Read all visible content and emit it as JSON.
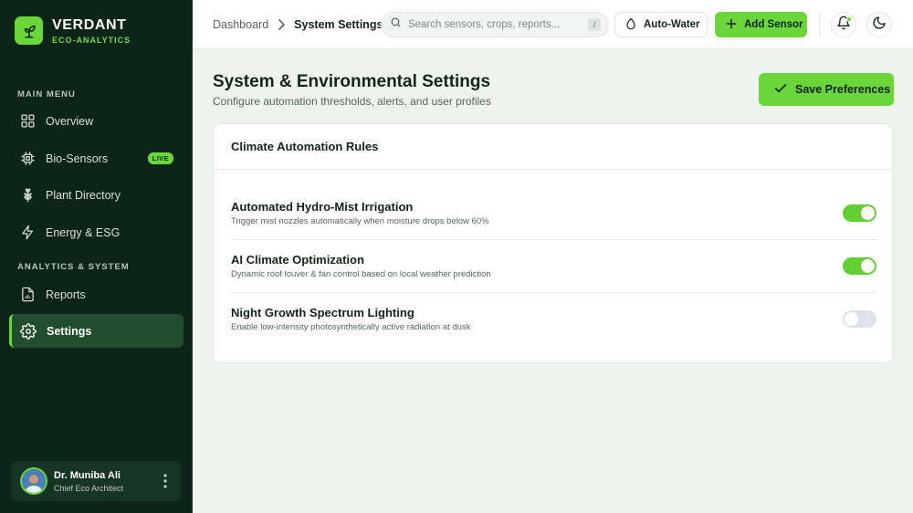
{
  "brand": {
    "name": "VERDANT",
    "subtitle": "ECO-ANALYTICS",
    "logo_icon": "sprout-icon"
  },
  "sidebar": {
    "sections": [
      {
        "title": "MAIN MENU"
      },
      {
        "title": "ANALYTICS & SYSTEM"
      }
    ],
    "items": [
      {
        "label": "Overview",
        "icon": "grid-icon"
      },
      {
        "label": "Bio-Sensors",
        "icon": "chip-icon",
        "badge": "LIVE"
      },
      {
        "label": "Plant Directory",
        "icon": "plant-icon"
      },
      {
        "label": "Energy & ESG",
        "icon": "bolt-icon"
      },
      {
        "label": "Reports",
        "icon": "report-icon"
      },
      {
        "label": "Settings",
        "icon": "gear-icon",
        "active": true
      }
    ]
  },
  "user": {
    "name": "Dr. Muniba Ali",
    "role": "Chief Eco Architect"
  },
  "header": {
    "breadcrumb": [
      "Dashboard",
      "System Settings"
    ],
    "search_placeholder": "Search sensors, crops, reports...",
    "search_shortcut": "/",
    "auto_water_label": "Auto-Water",
    "add_sensor_label": "Add Sensor"
  },
  "main": {
    "title": "System & Environmental Settings",
    "subtitle": "Configure automation thresholds, alerts, and user profiles",
    "save_label": "Save Preferences",
    "card": {
      "title": "Climate Automation Rules",
      "rules": [
        {
          "title": "Automated Hydro-Mist Irrigation",
          "description": "Trigger mist nozzles automatically when moisture drops below 60%",
          "enabled": true
        },
        {
          "title": "AI Climate Optimization",
          "description": "Dynamic roof louver & fan control based on local weather prediction",
          "enabled": true
        },
        {
          "title": "Night Growth Spectrum Lighting",
          "description": "Enable low-intensity photosynthetically active radiation at dusk",
          "enabled": false
        }
      ]
    }
  },
  "colors": {
    "accent": "#6ad63a",
    "sidebar_bg": "#0d2418",
    "page_bg": "#eef3ef",
    "toggle_off": "#dde3ea"
  }
}
